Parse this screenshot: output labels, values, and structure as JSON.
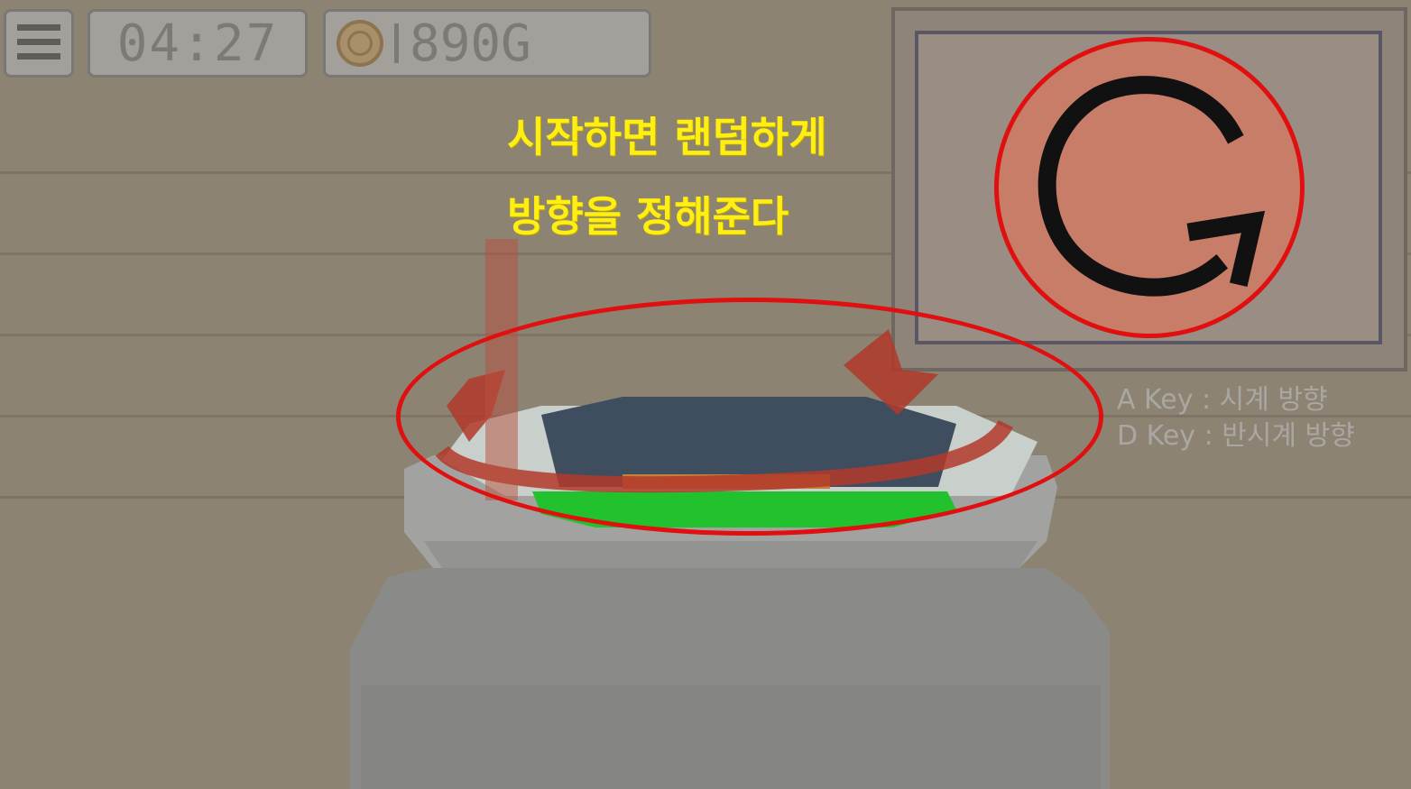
{
  "hud": {
    "menu_icon": "hamburger-menu-icon",
    "timer": "04:27",
    "coin_icon": "coin-icon",
    "gold": "890G"
  },
  "caption": {
    "line1": "시작하면 랜덤하게",
    "line2": "방향을 정해준다"
  },
  "direction_indicator": {
    "icon": "clockwise-arrow-icon",
    "highlight_color": "#e01010"
  },
  "key_help": {
    "a_key": "A Key : 시계 방향",
    "d_key": "D Key : 반시계 방향"
  },
  "colors": {
    "caption": "#ffee11",
    "liquid": "#22c22e",
    "arrow": "#b23a2a"
  }
}
